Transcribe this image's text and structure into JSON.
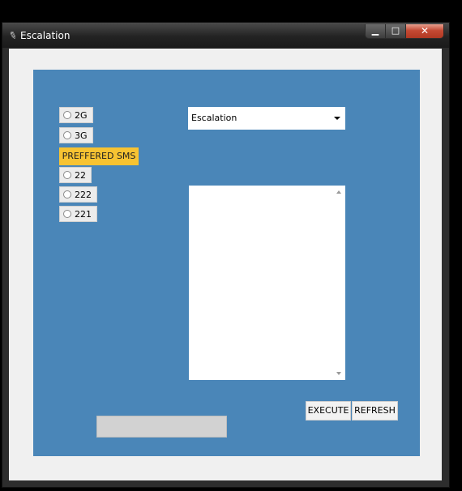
{
  "window": {
    "title": "Escalation"
  },
  "radios": [
    {
      "label": "2G"
    },
    {
      "label": "3G"
    },
    {
      "label": "22"
    },
    {
      "label": "222"
    },
    {
      "label": "221"
    }
  ],
  "sms_label": "PREFFERED SMS",
  "dropdown": {
    "selected": "Escalation"
  },
  "buttons": {
    "execute": "EXECUTE",
    "refresh": "REFRESH"
  },
  "progress": {
    "value": 0
  },
  "colors": {
    "panel": "#4a86b8",
    "label_bg": "#f7c332",
    "client_bg": "#f0f0f0"
  }
}
